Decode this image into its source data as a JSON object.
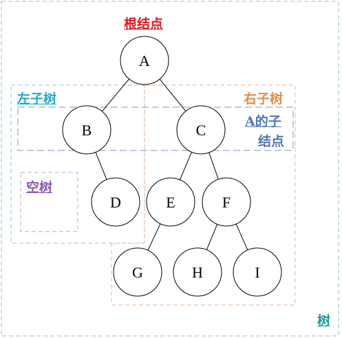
{
  "labels": {
    "root": "根结点",
    "left_subtree": "左子树",
    "right_subtree": "右子树",
    "children_of_a_line1": "A的子",
    "children_of_a_line2": "结点",
    "empty_tree": "空树",
    "tree": "树"
  },
  "colors": {
    "root": "#e0191e",
    "left_subtree": "#27a8c7",
    "right_subtree": "#e58a4d",
    "children_of_a": "#4f77b3",
    "empty_tree": "#8e54b8",
    "tree": "#1a9a99",
    "outer_border": "#8fc2d0",
    "node_stroke": "#000000",
    "edge": "#000000"
  },
  "nodes": [
    {
      "id": "A",
      "label": "A"
    },
    {
      "id": "B",
      "label": "B"
    },
    {
      "id": "C",
      "label": "C"
    },
    {
      "id": "D",
      "label": "D"
    },
    {
      "id": "E",
      "label": "E"
    },
    {
      "id": "F",
      "label": "F"
    },
    {
      "id": "G",
      "label": "G"
    },
    {
      "id": "H",
      "label": "H"
    },
    {
      "id": "I",
      "label": "I"
    }
  ],
  "edges": [
    [
      "A",
      "B"
    ],
    [
      "A",
      "C"
    ],
    [
      "B",
      "D"
    ],
    [
      "C",
      "E"
    ],
    [
      "C",
      "F"
    ],
    [
      "E",
      "G"
    ],
    [
      "F",
      "H"
    ],
    [
      "F",
      "I"
    ]
  ]
}
